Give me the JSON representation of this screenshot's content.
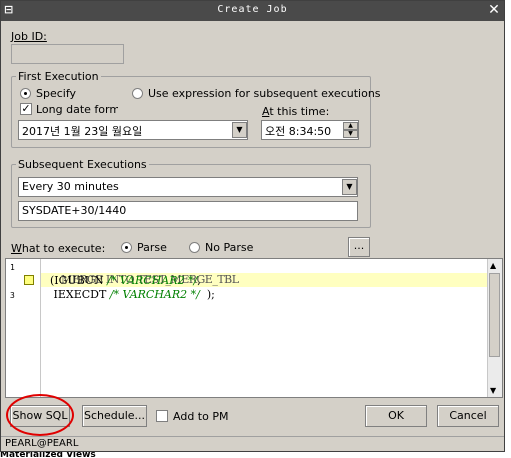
{
  "window": {
    "title": "Create Job"
  },
  "job_id": {
    "label": "Job ID:",
    "value": ""
  },
  "first_execution": {
    "title": "First Execution",
    "specify_label": "Specify",
    "expression_label": "Use expression for subsequent executions",
    "long_date_label": "Long date format",
    "date_value": "2017년  1월 23일 월요일",
    "time_label": "At this time:",
    "time_value": "오전  8:34:50"
  },
  "subsequent": {
    "title": "Subsequent Executions",
    "interval_value": "Every 30 minutes",
    "expression_value": "SYSDATE+30/1440"
  },
  "what": {
    "label": "What to execute:",
    "parse_label": "Parse",
    "noparse_label": "No Parse",
    "more_label": "..."
  },
  "editor": {
    "line_numbers": [
      "1",
      "3"
    ],
    "line1": "MERGE INTO TEST_MERGE_TBL",
    "line2_code": "  (IGUBUN ",
    "line2_comment": "/* VARCHAR2 */",
    "line2_end": ",",
    "line3_code": "   IEXECDT ",
    "line3_comment": "/* VARCHAR2 */",
    "line3_end": "  );"
  },
  "buttons": {
    "show_sql": "Show SQL",
    "schedule": "Schedule...",
    "add_to_pm": "Add to PM",
    "ok": "OK",
    "cancel": "Cancel"
  },
  "status": {
    "connection": "PEARL@PEARL"
  },
  "background": {
    "text": "Materialized Views"
  },
  "colors": {
    "title_bar": "#4a4a4a",
    "dialog": "#d4d0c8",
    "annotation": "#e00000",
    "comment": "#008000"
  }
}
